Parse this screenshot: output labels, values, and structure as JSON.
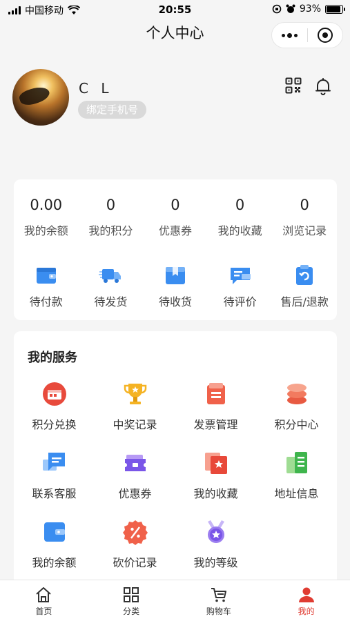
{
  "status_bar": {
    "carrier": "中国移动",
    "time": "20:55",
    "battery": "93%"
  },
  "nav": {
    "title": "个人中心"
  },
  "profile": {
    "name": "C L",
    "bind_phone_label": "绑定手机号"
  },
  "stats": [
    {
      "value": "0.00",
      "label": "我的余额"
    },
    {
      "value": "0",
      "label": "我的积分"
    },
    {
      "value": "0",
      "label": "优惠券"
    },
    {
      "value": "0",
      "label": "我的收藏"
    },
    {
      "value": "0",
      "label": "浏览记录"
    }
  ],
  "orders": [
    {
      "label": "待付款",
      "icon": "wallet-icon"
    },
    {
      "label": "待发货",
      "icon": "truck-icon"
    },
    {
      "label": "待收货",
      "icon": "package-icon"
    },
    {
      "label": "待评价",
      "icon": "review-icon"
    },
    {
      "label": "售后/退款",
      "icon": "refund-icon"
    }
  ],
  "services": {
    "title": "我的服务",
    "items": [
      {
        "label": "积分兑换",
        "icon": "points-exchange-icon"
      },
      {
        "label": "中奖记录",
        "icon": "trophy-icon"
      },
      {
        "label": "发票管理",
        "icon": "invoice-icon"
      },
      {
        "label": "积分中心",
        "icon": "coin-stack-icon"
      },
      {
        "label": "联系客服",
        "icon": "chat-icon"
      },
      {
        "label": "优惠券",
        "icon": "coupon-icon"
      },
      {
        "label": "我的收藏",
        "icon": "favorite-icon"
      },
      {
        "label": "地址信息",
        "icon": "address-icon"
      },
      {
        "label": "我的余额",
        "icon": "balance-card-icon"
      },
      {
        "label": "砍价记录",
        "icon": "bargain-icon"
      },
      {
        "label": "我的等级",
        "icon": "level-medal-icon"
      }
    ]
  },
  "tabbar": [
    {
      "label": "首页",
      "icon": "home-icon"
    },
    {
      "label": "分类",
      "icon": "category-icon"
    },
    {
      "label": "购物车",
      "icon": "cart-icon"
    },
    {
      "label": "我的",
      "icon": "user-icon",
      "active": true
    }
  ],
  "colors": {
    "accent": "#e03c32",
    "blue": "#3a8df0",
    "background": "#f5f5f5"
  }
}
